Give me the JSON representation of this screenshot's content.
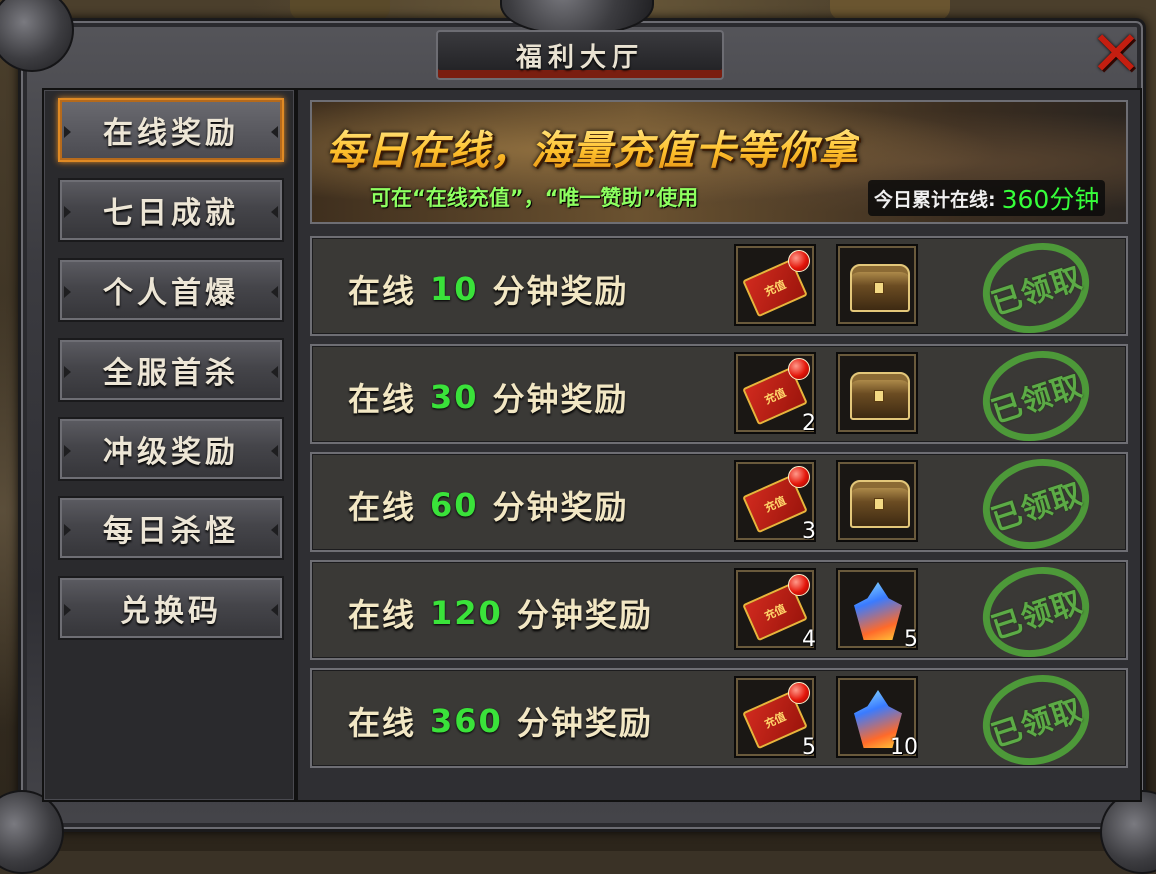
{
  "window": {
    "title": "福利大厅"
  },
  "sidebar": {
    "items": [
      {
        "label": "在线奖励",
        "active": true
      },
      {
        "label": "七日成就",
        "active": false
      },
      {
        "label": "个人首爆",
        "active": false
      },
      {
        "label": "全服首杀",
        "active": false
      },
      {
        "label": "冲级奖励",
        "active": false
      },
      {
        "label": "每日杀怪",
        "active": false
      },
      {
        "label": "兑换码",
        "active": false
      }
    ]
  },
  "banner": {
    "headline": "每日在线，海量充值卡等你拿",
    "subtitle": "可在“在线充值”，“唯一赞助”使用",
    "online_label": "今日累计在线:",
    "online_value": "360分钟"
  },
  "rewards": [
    {
      "prefix": "在线",
      "minutes": "10",
      "suffix": "分钟奖励",
      "item1": {
        "icon": "recharge-card-icon",
        "label": "充值",
        "qty": ""
      },
      "item2": {
        "icon": "treasure-chest-icon",
        "qty": ""
      },
      "status": "已领取"
    },
    {
      "prefix": "在线",
      "minutes": "30",
      "suffix": "分钟奖励",
      "item1": {
        "icon": "recharge-card-icon",
        "label": "充值",
        "qty": "2"
      },
      "item2": {
        "icon": "treasure-chest-icon",
        "qty": ""
      },
      "status": "已领取"
    },
    {
      "prefix": "在线",
      "minutes": "60",
      "suffix": "分钟奖励",
      "item1": {
        "icon": "recharge-card-icon",
        "label": "充值",
        "qty": "3"
      },
      "item2": {
        "icon": "treasure-chest-icon",
        "qty": ""
      },
      "status": "已领取"
    },
    {
      "prefix": "在线",
      "minutes": "120",
      "suffix": "分钟奖励",
      "item1": {
        "icon": "recharge-card-icon",
        "label": "充值",
        "qty": "4"
      },
      "item2": {
        "icon": "crystal-icon",
        "qty": "5"
      },
      "status": "已领取"
    },
    {
      "prefix": "在线",
      "minutes": "360",
      "suffix": "分钟奖励",
      "item1": {
        "icon": "recharge-card-icon",
        "label": "充值",
        "qty": "5"
      },
      "item2": {
        "icon": "crystal-icon",
        "qty": "10"
      },
      "status": "已领取"
    }
  ],
  "colors": {
    "accent_orange": "#e08a24",
    "green_text": "#3ae23a",
    "close_red": "#c41e10",
    "stamp_green": "#4fa23a"
  }
}
